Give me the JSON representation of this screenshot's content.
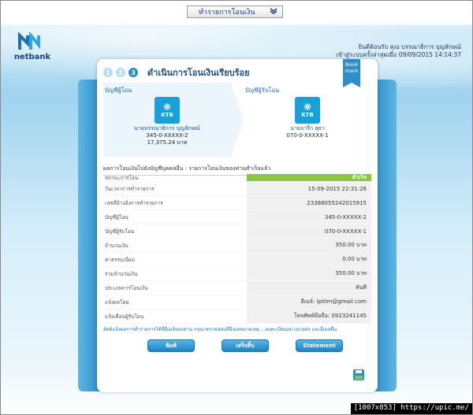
{
  "nav": {
    "dropdown_label": "ทำรายการโอนเงิน"
  },
  "brand": {
    "logo_text": "netbank"
  },
  "greeting": {
    "line1": "ยินดีต้อนรับ คุณ บรรณาธิการ บุญลักษณ์",
    "line2": "เข้าสู่ระบบครั้งล่าสุดเมื่อ 09/09/2015 14:14:37"
  },
  "steps": {
    "items": [
      "1",
      "2",
      "3"
    ],
    "title": "ดำเนินการโอนเงินเรียบร้อย"
  },
  "bookmark": {
    "line1": "Book",
    "line2": "mark"
  },
  "from_account": {
    "label": "บัญชีผู้โอน",
    "bank": "KTB",
    "name": "นายบรรณาธิการ บุญลักษณ์",
    "number": "345-0-XXXXX-2",
    "balance": "17,375.24 บาท"
  },
  "to_account": {
    "label": "บัญชีผู้รับโอน",
    "bank": "KTB",
    "name": "นายจารึก สุธา",
    "number": "070-0-XXXXX-1"
  },
  "result": {
    "title": "ผลการโอนเงินไปยังบัญชีบุคคลอื่น : รายการโอนเงินของท่านสำเร็จแล้ว",
    "rows": [
      {
        "label": "สถานะการโอน",
        "value": "สำเร็จ"
      },
      {
        "label": "วันเวลาการทำรายการ",
        "value": "15-09-2015 22:31:26"
      },
      {
        "label": "เลขที่อ้างอิงการทำรายการ",
        "value": "23388055242015915"
      },
      {
        "label": "บัญชีผู้โอน",
        "value": "345-0-XXXXX-2"
      },
      {
        "label": "บัญชีผู้รับโอน",
        "value": "070-0-XXXXX-1"
      },
      {
        "label": "จำนวนเงิน",
        "value": "350.00 บาท"
      },
      {
        "label": "ค่าธรรมเนียม",
        "value": "0.00 บาท"
      },
      {
        "label": "รวมจำนวนเงิน",
        "value": "350.00 บาท"
      },
      {
        "label": "ประเภทการโอนเงิน",
        "value": "ทันที"
      },
      {
        "label": "แจ้งผลโดย",
        "value": "อีเมล์: ipitim@gmail.com"
      },
      {
        "label": "แจ้งเตือนผู้รับโอน",
        "value": "โทรศัพท์มือถือ: 0923241145"
      }
    ]
  },
  "note": "อัตต์แจ้งผลการทำรายการได้ที่อีเมล์ของท่าน กรุณาตรวจสอบที่อีเมลหมายเหตุ ...ลงทะเบียนอย่างง่ายส่ง และอีเมลอื่น",
  "buttons": {
    "print": "พิมพ์",
    "done": "เสร็จสิ้น",
    "statement": "Statement"
  },
  "watermark": "[1007x853] https://upic.me/",
  "colors": {
    "accent": "#2c8fc9",
    "success": "#8cc63f",
    "ktb": "#1aa0d8"
  }
}
